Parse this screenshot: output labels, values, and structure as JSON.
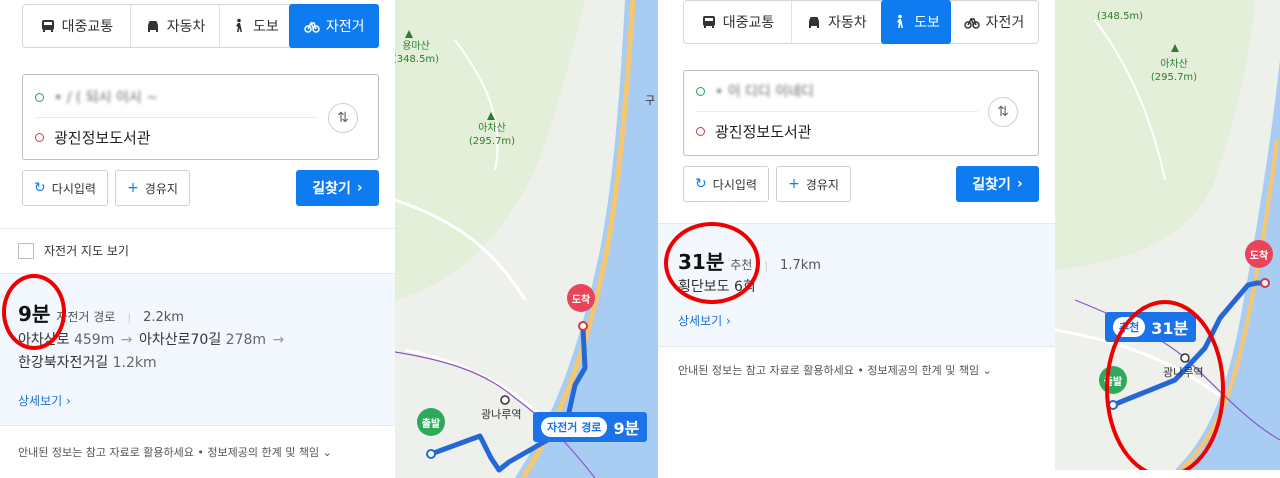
{
  "left": {
    "tabs": [
      {
        "label": "대중교통",
        "icon": "bus-icon"
      },
      {
        "label": "자동차",
        "icon": "car-icon"
      },
      {
        "label": "도보",
        "icon": "walk-icon"
      },
      {
        "label": "자전거",
        "icon": "bicycle-icon",
        "active": true
      }
    ],
    "origin": "• / ( 되시 이시 ~",
    "destination": "광진정보도서관",
    "reset_label": "다시입력",
    "waypoint_label": "경유지",
    "search_label": "길찾기",
    "bike_map_label": "자전거 지도 보기",
    "result": {
      "time": "9분",
      "route_type": "자전거 경로",
      "distance": "2.2km",
      "path": [
        {
          "name": "아차산로",
          "dist": "459m"
        },
        {
          "name": "아차산로70길",
          "dist": "278m"
        },
        {
          "name": "한강북자전거길",
          "dist": "1.2km"
        }
      ],
      "detail_label": "상세보기"
    },
    "disclaimer": "안내된 정보는 참고 자료로 활용하세요 • 정보제공의 한계 및 책임"
  },
  "map1": {
    "peaks": [
      {
        "name": "용마산",
        "height": "(348.5m)"
      },
      {
        "name": "아차산",
        "height": "(295.7m)"
      }
    ],
    "road_label": "구",
    "start": "출발",
    "end": "도착",
    "station": "광나루역",
    "route_badge": {
      "tag": "자전거 경로",
      "time": "9분"
    }
  },
  "right": {
    "tabs": [
      {
        "label": "대중교통",
        "icon": "bus-icon"
      },
      {
        "label": "자동차",
        "icon": "car-icon"
      },
      {
        "label": "도보",
        "icon": "walk-icon",
        "active": true
      },
      {
        "label": "자전거",
        "icon": "bicycle-icon"
      }
    ],
    "origin": "• 이 디디 이네디",
    "destination": "광진정보도서관",
    "reset_label": "다시입력",
    "waypoint_label": "경유지",
    "search_label": "길찾기",
    "result": {
      "time": "31분",
      "route_type": "추천",
      "distance": "1.7km",
      "summary": "횡단보도 6회",
      "detail_label": "상세보기"
    },
    "disclaimer": "안내된 정보는 참고 자료로 활용하세요 • 정보제공의 한계 및 책임"
  },
  "map2": {
    "peaks": [
      {
        "name": "",
        "height": "(348.5m)"
      },
      {
        "name": "아차산",
        "height": "(295.7m)"
      }
    ],
    "start": "출발",
    "end": "도착",
    "station": "광나루역",
    "route_badge": {
      "tag": "추천",
      "time": "31분"
    }
  },
  "colors": {
    "accent": "#0e7cf0",
    "route": "#2667d6",
    "river": "#a9cdf2",
    "park": "#e3efd8",
    "highlight": "#e00000"
  }
}
